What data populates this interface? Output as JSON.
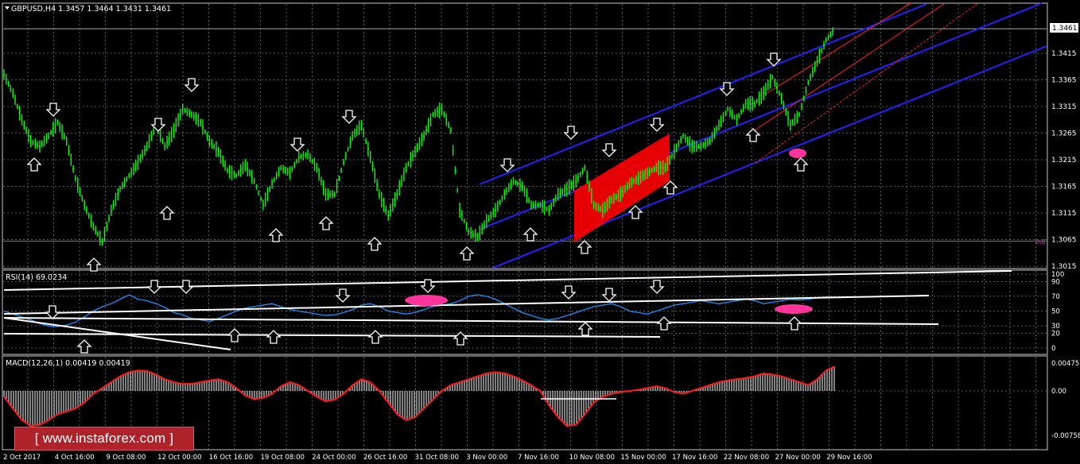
{
  "chart_data": [
    {
      "type": "candlestick",
      "title": "GBPUSD,H4  1.3457 1.3464 1.3431 1.3461",
      "last_price_label": "1.3461",
      "level_label": "0.0",
      "y_ticks": [
        "1.3415",
        "1.3365",
        "1.3315",
        "1.3265",
        "1.3215",
        "1.3165",
        "1.3115",
        "1.3065",
        "1.3015"
      ],
      "y_tick_values": [
        1.3415,
        1.3365,
        1.3315,
        1.3265,
        1.3215,
        1.3165,
        1.3115,
        1.3065,
        1.3015
      ],
      "x_ticks": [
        "2 Oct 2017",
        "4 Oct 16:00",
        "9 Oct 08:00",
        "12 Oct 00:00",
        "16 Oct 16:00",
        "19 Oct 08:00",
        "24 Oct 00:00",
        "26 Oct 16:00",
        "31 Oct 08:00",
        "3 Nov 00:00",
        "7 Nov 16:00",
        "10 Nov 08:00",
        "15 Nov 00:00",
        "17 Nov 16:00",
        "22 Nov 08:00",
        "27 Nov 00:00",
        "29 Nov 16:00"
      ],
      "close_path": [
        1.3375,
        1.334,
        1.329,
        1.325,
        1.324,
        1.326,
        1.3285,
        1.325,
        1.318,
        1.313,
        1.309,
        1.306,
        1.312,
        1.316,
        1.3185,
        1.321,
        1.324,
        1.328,
        1.324,
        1.327,
        1.331,
        1.33,
        1.3285,
        1.325,
        1.323,
        1.3195,
        1.3185,
        1.3205,
        1.3175,
        1.313,
        1.317,
        1.32,
        1.319,
        1.322,
        1.3225,
        1.32,
        1.315,
        1.315,
        1.321,
        1.326,
        1.328,
        1.322,
        1.315,
        1.311,
        1.315,
        1.32,
        1.323,
        1.326,
        1.33,
        1.331,
        1.327,
        1.312,
        1.308,
        1.307,
        1.31,
        1.312,
        1.315,
        1.3175,
        1.3165,
        1.313,
        1.313,
        1.312,
        1.315,
        1.316,
        1.3175,
        1.32,
        1.313,
        1.312,
        1.314,
        1.315,
        1.317,
        1.318,
        1.319,
        1.32,
        1.32,
        1.323,
        1.326,
        1.324,
        1.324,
        1.325,
        1.328,
        1.331,
        1.329,
        1.332,
        1.332,
        1.334,
        1.337,
        1.333,
        1.328,
        1.33,
        1.336,
        1.34,
        1.344,
        1.3461
      ],
      "level_line": 1.3062,
      "channels": "blue regression channel (3 lines) and red channel (3 lines), rising to the right",
      "colors": {
        "bull": "#00ff00",
        "bear": "#00ff00",
        "channel_blue": "#2222ff",
        "channel_red": "#ff2020",
        "level": "#cc33cc",
        "grid": "#6e7780"
      }
    },
    {
      "type": "line",
      "title": "RSI(14) 69.0234",
      "y_ticks": [
        "100",
        "90",
        "70",
        "50",
        "30",
        "20",
        "0"
      ],
      "y_tick_values": [
        100,
        90,
        70,
        50,
        30,
        20,
        0
      ],
      "values": [
        50,
        46,
        42,
        38,
        33,
        30,
        29,
        31,
        35,
        42,
        50,
        56,
        60,
        66,
        72,
        66,
        64,
        60,
        55,
        48,
        45,
        40,
        38,
        36,
        40,
        45,
        50,
        54,
        56,
        58,
        60,
        56,
        52,
        50,
        48,
        46,
        44,
        45,
        48,
        52,
        58,
        60,
        56,
        50,
        48,
        46,
        48,
        52,
        56,
        58,
        60,
        64,
        70,
        72,
        70,
        66,
        60,
        54,
        48,
        44,
        40,
        38,
        40,
        44,
        48,
        52,
        56,
        58,
        60,
        56,
        50,
        48,
        46,
        50,
        54,
        58,
        60,
        62,
        64,
        62,
        60,
        62,
        64,
        66,
        64,
        60,
        62,
        64,
        66,
        65,
        66,
        68,
        69,
        69
      ],
      "color": "#1e90ff"
    },
    {
      "type": "bar",
      "title": "MACD(12,26,1) 0.00419 0.00419",
      "y_ticks": [
        "0.00475",
        "0.00",
        "-0.00758"
      ],
      "y_tick_values": [
        0.00475,
        0.0,
        -0.00758
      ],
      "values": [
        -0.001,
        -0.003,
        -0.005,
        -0.006,
        -0.0058,
        -0.005,
        -0.004,
        -0.0035,
        -0.003,
        -0.002,
        -0.0005,
        0.0005,
        0.0015,
        0.0025,
        0.0032,
        0.0035,
        0.0034,
        0.0028,
        0.002,
        0.0015,
        0.0012,
        0.0012,
        0.0015,
        0.0018,
        0.002,
        0.0015,
        0.0005,
        -0.0008,
        -0.0014,
        -0.0012,
        -0.0005,
        0.0008,
        0.0015,
        0.001,
        0.0,
        -0.001,
        -0.0018,
        -0.0015,
        -0.0005,
        0.001,
        0.002,
        0.0015,
        0.0,
        -0.002,
        -0.004,
        -0.005,
        -0.0045,
        -0.003,
        -0.0015,
        0.0,
        0.001,
        0.0015,
        0.002,
        0.0025,
        0.003,
        0.0032,
        0.003,
        0.0025,
        0.0018,
        0.001,
        0.0,
        -0.0025,
        -0.0045,
        -0.006,
        -0.0058,
        -0.004,
        -0.002,
        -0.001,
        -0.0005,
        -0.0002,
        0.0,
        0.0002,
        0.0005,
        0.0008,
        0.0005,
        -0.0002,
        -0.0005,
        0.0,
        0.0005,
        0.001,
        0.0015,
        0.0018,
        0.002,
        0.0022,
        0.0025,
        0.003,
        0.0028,
        0.0025,
        0.002,
        0.0015,
        0.001,
        0.002,
        0.0035,
        0.0042
      ],
      "line_color": "#ff1a1a",
      "bar_color": "#ffffff"
    }
  ],
  "watermark": "[ www.instaforex.com ]"
}
